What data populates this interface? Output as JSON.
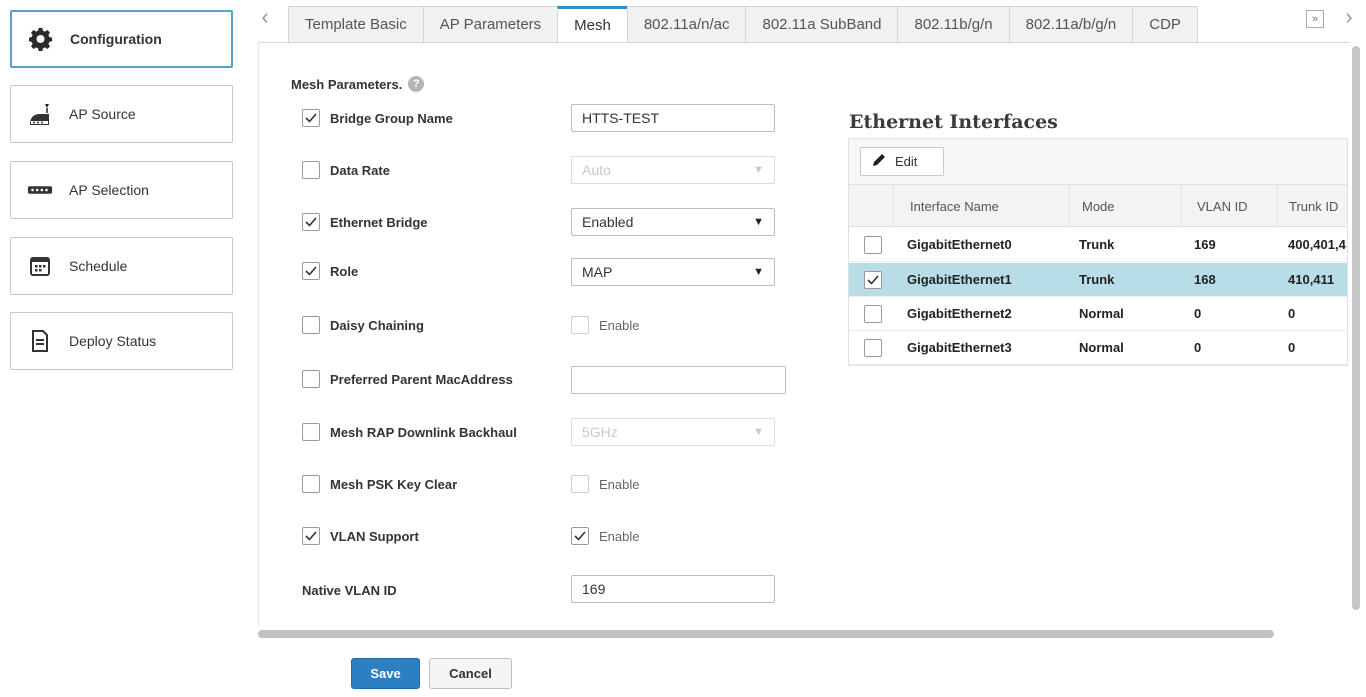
{
  "nav": {
    "items": [
      {
        "label": "Configuration",
        "icon": "gear-icon",
        "active": true
      },
      {
        "label": "AP Source",
        "icon": "access-point-icon",
        "active": false
      },
      {
        "label": "AP Selection",
        "icon": "ap-device-icon",
        "active": false
      },
      {
        "label": "Schedule",
        "icon": "calendar-icon",
        "active": false
      },
      {
        "label": "Deploy Status",
        "icon": "document-icon",
        "active": false
      }
    ]
  },
  "tabs": [
    "Template Basic",
    "AP Parameters",
    "Mesh",
    "802.11a/n/ac",
    "802.11a SubBand",
    "802.11b/g/n",
    "802.11a/b/g/n",
    "CDP"
  ],
  "active_tab": "Mesh",
  "mesh": {
    "section_title": "Mesh Parameters.",
    "help_icon": "?",
    "bridge_group_name": {
      "label": "Bridge Group Name",
      "checked": true,
      "value": "HTTS-TEST"
    },
    "data_rate": {
      "label": "Data Rate",
      "checked": false,
      "value": "Auto"
    },
    "ethernet_bridge": {
      "label": "Ethernet Bridge",
      "checked": true,
      "value": "Enabled"
    },
    "role": {
      "label": "Role",
      "checked": true,
      "value": "MAP"
    },
    "daisy_chaining": {
      "label": "Daisy Chaining",
      "checked": false,
      "enable_label": "Enable",
      "enable_checked": false
    },
    "preferred_parent": {
      "label": "Preferred Parent MacAddress",
      "checked": false,
      "value": ""
    },
    "rap_downlink": {
      "label": "Mesh RAP Downlink Backhaul",
      "checked": false,
      "value": "5GHz"
    },
    "psk_key_clear": {
      "label": "Mesh PSK Key Clear",
      "checked": false,
      "enable_label": "Enable",
      "enable_checked": false
    },
    "vlan_support": {
      "label": "VLAN Support",
      "checked": true,
      "enable_label": "Enable",
      "enable_checked": true
    },
    "native_vlan_id": {
      "label": "Native VLAN ID",
      "value": "169"
    }
  },
  "ethernet": {
    "title": "Ethernet Interfaces",
    "edit_label": "Edit",
    "columns": [
      "Interface Name",
      "Mode",
      "VLAN ID",
      "Trunk ID"
    ],
    "rows": [
      {
        "name": "GigabitEthernet0",
        "mode": "Trunk",
        "vlan": "169",
        "trunk": "400,401,4",
        "selected": false
      },
      {
        "name": "GigabitEthernet1",
        "mode": "Trunk",
        "vlan": "168",
        "trunk": "410,411",
        "selected": true
      },
      {
        "name": "GigabitEthernet2",
        "mode": "Normal",
        "vlan": "0",
        "trunk": "0",
        "selected": false
      },
      {
        "name": "GigabitEthernet3",
        "mode": "Normal",
        "vlan": "0",
        "trunk": "0",
        "selected": false
      }
    ]
  },
  "footer": {
    "save_label": "Save",
    "cancel_label": "Cancel"
  },
  "colors": {
    "accent": "#2b7fc3",
    "active_tab_border": "#2d8ec4",
    "selected_row": "#b9dde8",
    "active_nav_border": "#5aa0c8"
  }
}
